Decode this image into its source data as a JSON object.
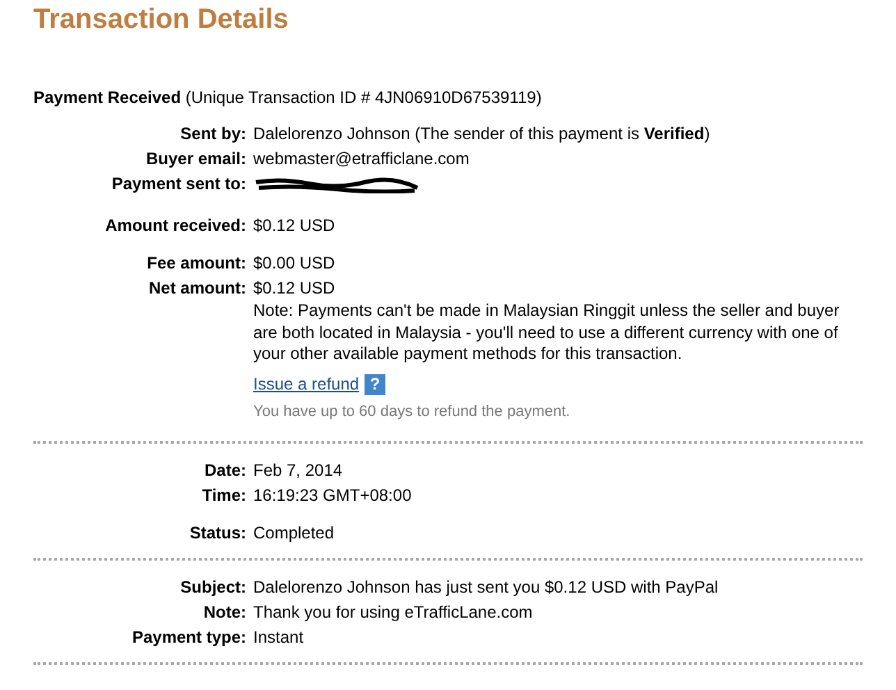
{
  "title": "Transaction Details",
  "sections": [
    {
      "heading": "**Payment Received** (Unique Transaction ID # 4JN06910D67539119)",
      "groups": [
        [
          {
            "kind": "text",
            "label": "Sent by:",
            "value": "Dalelorenzo Johnson (The sender of this payment is **Verified**)"
          },
          {
            "kind": "text",
            "label": "Buyer email:",
            "value": "webmaster@etrafficlane.com"
          },
          {
            "kind": "redacted",
            "label": "Payment sent to:"
          }
        ],
        [
          {
            "kind": "text",
            "label": "Amount received:",
            "value": "$0.12 USD"
          }
        ],
        [
          {
            "kind": "text",
            "label": "Fee amount:",
            "value": "$0.00 USD"
          },
          {
            "kind": "text",
            "label": "Net amount:",
            "value": "$0.12 USD"
          }
        ]
      ],
      "note": "Note: Payments can't be made in Malaysian Ringgit unless the seller and buyer are both located in Malaysia - you'll need to use a different currency with one of your other available payment methods for this transaction.",
      "refund_link": "Issue a refund",
      "help_icon": "?",
      "refund_hint": "You have up to 60 days to refund the payment."
    },
    {
      "groups": [
        [
          {
            "kind": "text",
            "label": "Date:",
            "value": "Feb 7, 2014"
          },
          {
            "kind": "text",
            "label": "Time:",
            "value": "16:19:23 GMT+08:00"
          }
        ],
        [
          {
            "kind": "text",
            "label": "Status:",
            "value": "Completed"
          }
        ]
      ]
    },
    {
      "groups": [
        [
          {
            "kind": "text",
            "label": "Subject:",
            "value": "Dalelorenzo Johnson has just sent you $0.12 USD with PayPal"
          },
          {
            "kind": "text",
            "label": "Note:",
            "value": "Thank you for using eTrafficLane.com"
          },
          {
            "kind": "text",
            "label": "Payment type:",
            "value": "Instant"
          }
        ]
      ]
    }
  ]
}
